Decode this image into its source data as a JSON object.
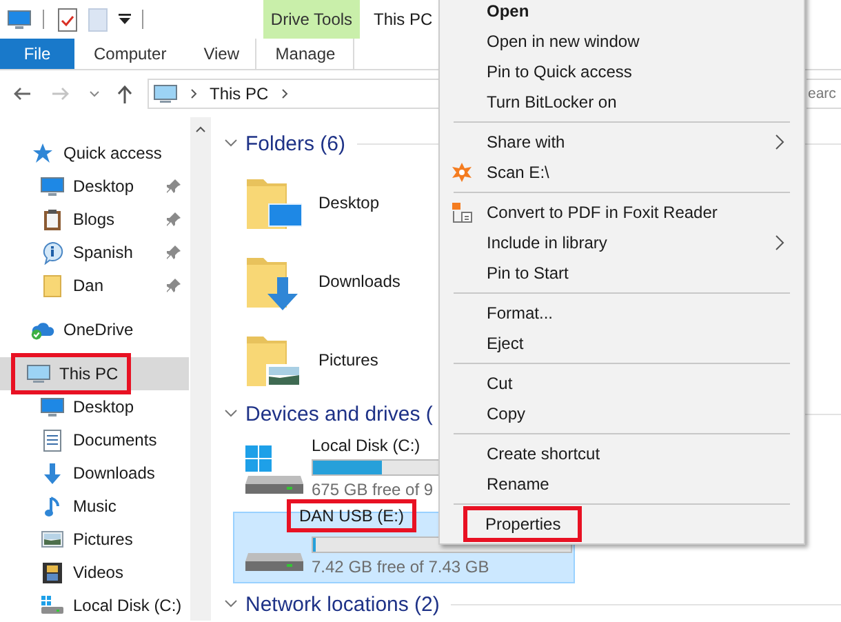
{
  "window": {
    "title": "This PC"
  },
  "ribbon": {
    "context_group": "Drive Tools",
    "tabs": [
      {
        "label": "File",
        "kind": "file",
        "selected": false
      },
      {
        "label": "Computer",
        "kind": "tab",
        "selected": false
      },
      {
        "label": "View",
        "kind": "tab",
        "selected": false
      },
      {
        "label": "Manage",
        "kind": "context",
        "selected": false
      }
    ]
  },
  "address_bar": {
    "path": [
      "This PC"
    ]
  },
  "search": {
    "placeholder": "earc"
  },
  "navigation": [
    {
      "label": "Quick access",
      "selected": false,
      "highlighted": false,
      "children": [
        {
          "label": "Desktop",
          "pinned": true
        },
        {
          "label": "Blogs",
          "pinned": true
        },
        {
          "label": "Spanish",
          "pinned": true
        },
        {
          "label": "Dan",
          "pinned": true
        }
      ]
    },
    {
      "label": "OneDrive",
      "selected": false,
      "highlighted": false
    },
    {
      "label": "This PC",
      "selected": true,
      "highlighted": true,
      "children": [
        {
          "label": "Desktop",
          "pinned": false
        },
        {
          "label": "Documents",
          "pinned": false
        },
        {
          "label": "Downloads",
          "pinned": false
        },
        {
          "label": "Music",
          "pinned": false
        },
        {
          "label": "Pictures",
          "pinned": false
        },
        {
          "label": "Videos",
          "pinned": false
        },
        {
          "label": "Local Disk (C:)",
          "pinned": false
        }
      ]
    }
  ],
  "content": {
    "groups": [
      {
        "title": "Folders (6)",
        "kind": "folders",
        "items": [
          {
            "name": "Desktop"
          },
          {
            "name": "Downloads"
          },
          {
            "name": "Pictures"
          }
        ]
      },
      {
        "title": "Devices and drives (",
        "kind": "drives",
        "items": [
          {
            "name": "Local Disk (C:)",
            "level": 0.27,
            "free": "675 GB free of 9",
            "selected": false,
            "highlighted": false
          },
          {
            "name": "DAN USB (E:)",
            "level": 0.01,
            "free": "7.42 GB free of 7.43 GB",
            "selected": true,
            "highlighted": true
          }
        ]
      },
      {
        "title": "Network locations (2)",
        "kind": "network"
      }
    ]
  },
  "context_menu": [
    {
      "kind": "item",
      "label": "Open",
      "default": true
    },
    {
      "kind": "item",
      "label": "Open in new window"
    },
    {
      "kind": "item",
      "label": "Pin to Quick access"
    },
    {
      "kind": "item",
      "label": "Turn BitLocker on"
    },
    {
      "kind": "separator"
    },
    {
      "kind": "item",
      "label": "Share with",
      "submenu": true
    },
    {
      "kind": "item",
      "label": "Scan E:\\"
    },
    {
      "kind": "separator"
    },
    {
      "kind": "item",
      "label": "Convert to PDF in Foxit Reader"
    },
    {
      "kind": "item",
      "label": "Include in library",
      "submenu": true
    },
    {
      "kind": "item",
      "label": "Pin to Start"
    },
    {
      "kind": "separator"
    },
    {
      "kind": "item",
      "label": "Format..."
    },
    {
      "kind": "item",
      "label": "Eject"
    },
    {
      "kind": "separator"
    },
    {
      "kind": "item",
      "label": "Cut"
    },
    {
      "kind": "item",
      "label": "Copy"
    },
    {
      "kind": "separator"
    },
    {
      "kind": "item",
      "label": "Create shortcut"
    },
    {
      "kind": "item",
      "label": "Rename"
    },
    {
      "kind": "separator"
    },
    {
      "kind": "item",
      "label": "Properties",
      "highlighted": true
    }
  ]
}
